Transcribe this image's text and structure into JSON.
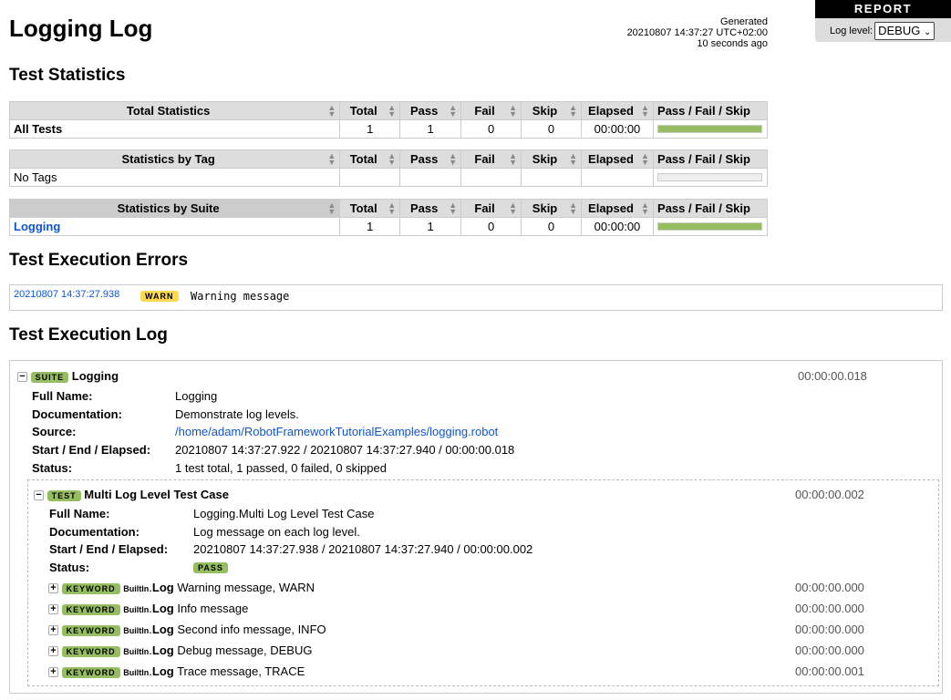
{
  "title": "Logging Log",
  "generated": {
    "label": "Generated",
    "timestamp": "20210807 14:37:27 UTC+02:00",
    "ago": "10 seconds ago"
  },
  "report": {
    "link": "REPORT",
    "log_level_label": "Log level:",
    "log_level": "DEBUG"
  },
  "sections": {
    "statistics": "Test Statistics",
    "errors": "Test Execution Errors",
    "log": "Test Execution Log"
  },
  "columns": [
    "Total",
    "Pass",
    "Fail",
    "Skip",
    "Elapsed",
    "Pass / Fail / Skip"
  ],
  "stat_tables": [
    {
      "header": "Total Statistics",
      "rows": [
        {
          "name": "All Tests",
          "bold": true,
          "total": "1",
          "pass": "1",
          "fail": "0",
          "skip": "0",
          "elapsed": "00:00:00",
          "pass_ratio": 1
        }
      ]
    },
    {
      "header": "Statistics by Tag",
      "rows": [
        {
          "name": "No Tags",
          "total": "",
          "pass": "",
          "fail": "",
          "skip": "",
          "elapsed": "",
          "pass_ratio": 0
        }
      ]
    },
    {
      "header": "Statistics by Suite",
      "sorted": true,
      "rows": [
        {
          "name": "Logging",
          "link": true,
          "total": "1",
          "pass": "1",
          "fail": "0",
          "skip": "0",
          "elapsed": "00:00:00",
          "pass_ratio": 1
        }
      ]
    }
  ],
  "errors": [
    {
      "timestamp": "20210807 14:37:27.938",
      "level": "WARN",
      "message": "Warning message"
    }
  ],
  "suite": {
    "label": "SUITE",
    "name": "Logging",
    "elapsed": "00:00:00.018",
    "meta": [
      {
        "k": "Full Name:",
        "v": "Logging"
      },
      {
        "k": "Documentation:",
        "v": "Demonstrate log levels."
      },
      {
        "k": "Source:",
        "v": "/home/adam/RobotFrameworkTutorialExamples/logging.robot",
        "link": true
      },
      {
        "k": "Start / End / Elapsed:",
        "v": "20210807 14:37:27.922 / 20210807 14:37:27.940 / 00:00:00.018"
      },
      {
        "k": "Status:",
        "v": "1 test total, 1 passed, 0 failed, 0 skipped"
      }
    ]
  },
  "test": {
    "label": "TEST",
    "name": "Multi Log Level Test Case",
    "elapsed": "00:00:00.002",
    "meta": [
      {
        "k": "Full Name:",
        "v": "Logging.Multi Log Level Test Case"
      },
      {
        "k": "Documentation:",
        "v": "Log message on each log level."
      },
      {
        "k": "Start / End / Elapsed:",
        "v": "20210807 14:37:27.938 / 20210807 14:37:27.940 / 00:00:00.002"
      },
      {
        "k": "Status:",
        "v": "PASS",
        "badge": true
      }
    ]
  },
  "keywords": [
    {
      "label": "KEYWORD",
      "lib": "BuiltIn",
      "name": "Log",
      "args": "Warning message, WARN",
      "elapsed": "00:00:00.000"
    },
    {
      "label": "KEYWORD",
      "lib": "BuiltIn",
      "name": "Log",
      "args": "Info message",
      "elapsed": "00:00:00.000"
    },
    {
      "label": "KEYWORD",
      "lib": "BuiltIn",
      "name": "Log",
      "args": "Second info message, INFO",
      "elapsed": "00:00:00.000"
    },
    {
      "label": "KEYWORD",
      "lib": "BuiltIn",
      "name": "Log",
      "args": "Debug message, DEBUG",
      "elapsed": "00:00:00.000"
    },
    {
      "label": "KEYWORD",
      "lib": "BuiltIn",
      "name": "Log",
      "args": "Trace message, TRACE",
      "elapsed": "00:00:00.001"
    }
  ],
  "colors": {
    "pass": "#97bd61",
    "warn": "#fed84f",
    "link": "#1155cc"
  }
}
